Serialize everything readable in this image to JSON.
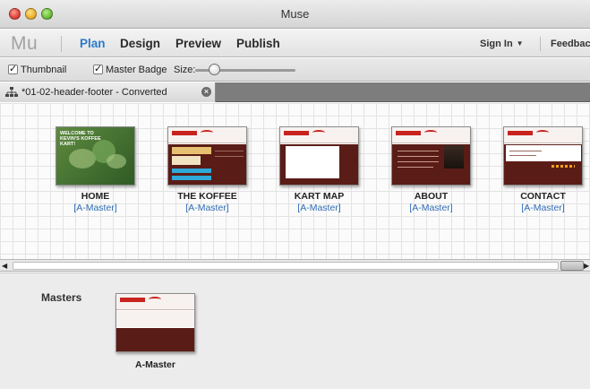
{
  "window": {
    "title": "Muse",
    "controls": [
      "close-button",
      "minimize-button",
      "zoom-button"
    ]
  },
  "modebar": {
    "logo": "Mu",
    "modes": [
      {
        "label": "Plan",
        "active": true
      },
      {
        "label": "Design",
        "active": false
      },
      {
        "label": "Preview",
        "active": false
      },
      {
        "label": "Publish",
        "active": false
      }
    ],
    "sign_in": "Sign In",
    "feedback": "Feedbac"
  },
  "options": {
    "thumbnail_label": "Thumbnail",
    "thumbnail_checked": true,
    "master_badge_label": "Master Badge",
    "master_badge_checked": true,
    "size_label": "Size:",
    "size_level": 0.15
  },
  "tab": {
    "label": "*01-02-header-footer - Converted",
    "icon": "sitemap-icon"
  },
  "pages": [
    {
      "name": "HOME",
      "master": "[A-Master]",
      "thumb_text": "WELCOME TO KEVIN'S KOFFEE KART!"
    },
    {
      "name": "THE KOFFEE",
      "master": "[A-Master]"
    },
    {
      "name": "KART MAP",
      "master": "[A-Master]"
    },
    {
      "name": "ABOUT",
      "master": "[A-Master]"
    },
    {
      "name": "CONTACT",
      "master": "[A-Master]"
    }
  ],
  "masters": {
    "label": "Masters",
    "items": [
      {
        "name": "A-Master"
      }
    ]
  },
  "colors": {
    "accent": "#2a7bc9",
    "master_link": "#2f6cb5",
    "site_red": "#c8231e",
    "site_brown": "#5a1c16"
  }
}
